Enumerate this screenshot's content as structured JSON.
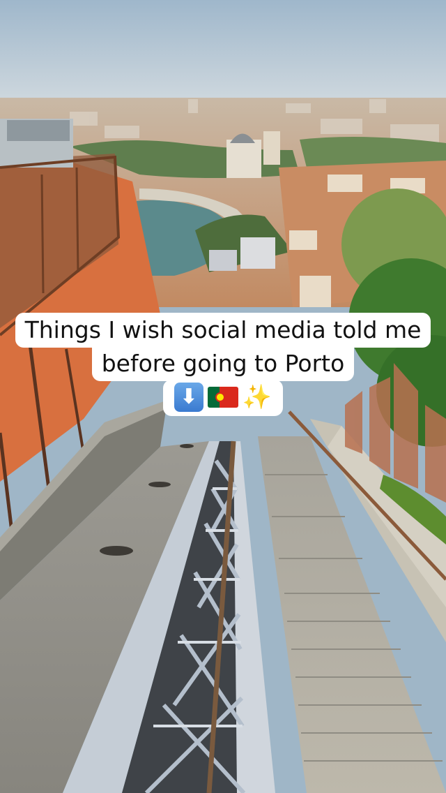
{
  "caption": {
    "line1": "Things I wish social media told me",
    "line2": "before going to Porto",
    "emojis": [
      "down-arrow-emoji",
      "portugal-flag-emoji",
      "sparkles-emoji"
    ]
  },
  "colors": {
    "sky": "#aec3d3",
    "river": "#5b8a8c",
    "wall": "#d8703f",
    "stone": "#9a9890",
    "rail": "#b9c3cf"
  }
}
